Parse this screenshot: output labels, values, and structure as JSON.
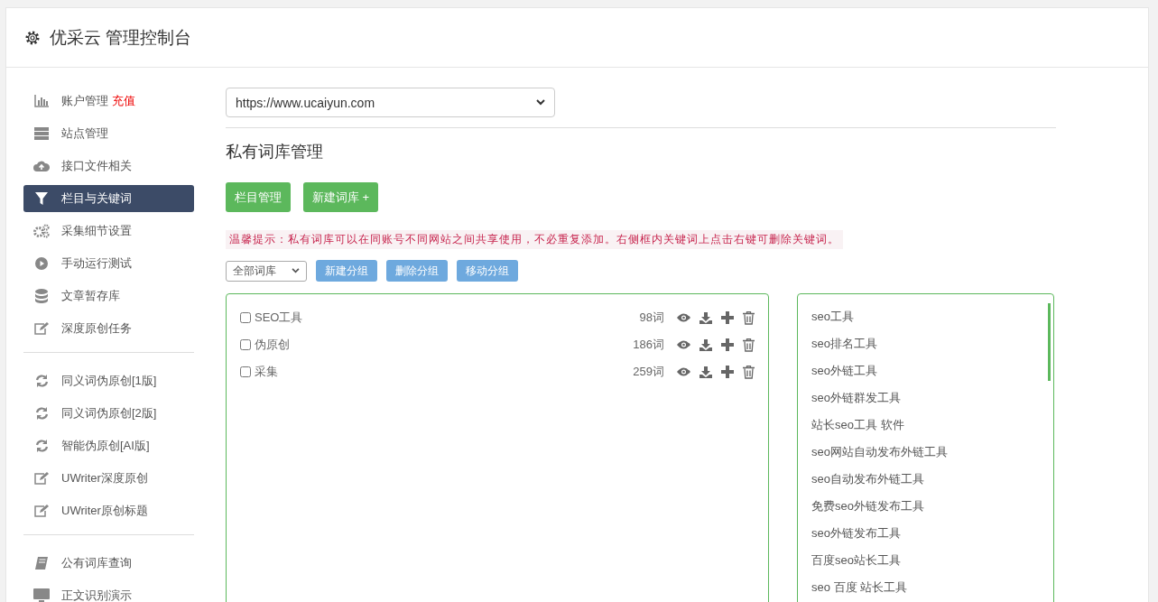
{
  "header": {
    "title": "优采云 管理控制台"
  },
  "sidebar": {
    "groups": [
      {
        "items": [
          {
            "label": "账户管理",
            "badge": "充值",
            "selected": false
          },
          {
            "label": "站点管理",
            "selected": false
          },
          {
            "label": "接口文件相关",
            "selected": false
          },
          {
            "label": "栏目与关键词",
            "selected": true
          },
          {
            "label": "采集细节设置",
            "selected": false
          },
          {
            "label": "手动运行测试",
            "selected": false
          },
          {
            "label": "文章暂存库",
            "selected": false
          },
          {
            "label": "深度原创任务",
            "selected": false
          }
        ]
      },
      {
        "items": [
          {
            "label": "同义词伪原创[1版]",
            "selected": false
          },
          {
            "label": "同义词伪原创[2版]",
            "selected": false
          },
          {
            "label": "智能伪原创[AI版]",
            "selected": false
          },
          {
            "label": "UWriter深度原创",
            "selected": false
          },
          {
            "label": "UWriter原创标题",
            "selected": false
          }
        ]
      },
      {
        "items": [
          {
            "label": "公有词库查询",
            "selected": false
          },
          {
            "label": "正文识别演示",
            "selected": false
          }
        ]
      }
    ]
  },
  "main": {
    "site_select": "https://www.ucaiyun.com",
    "heading": "私有词库管理",
    "buttons": [
      "栏目管理",
      "新建词库 +"
    ],
    "tip": "温馨提示：私有词库可以在同账号不同网站之间共享使用，不必重复添加。右侧框内关键词上点击右键可删除关键词。",
    "library_select": "全部词库",
    "group_buttons": [
      "新建分组",
      "删除分组",
      "移动分组"
    ],
    "libraries": [
      {
        "name": "SEO工具",
        "count": "98词",
        "checked": false
      },
      {
        "name": "伪原创",
        "count": "186词",
        "checked": false
      },
      {
        "name": "采集",
        "count": "259词",
        "checked": false
      }
    ],
    "keywords": [
      "seo工具",
      "seo排名工具",
      "seo外链工具",
      "seo外链群发工具",
      "站长seo工具 软件",
      "seo网站自动发布外链工具",
      "seo自动发布外链工具",
      "免费seo外链发布工具",
      "seo外链发布工具",
      "百度seo站长工具",
      "seo 百度 站长工具"
    ]
  }
}
